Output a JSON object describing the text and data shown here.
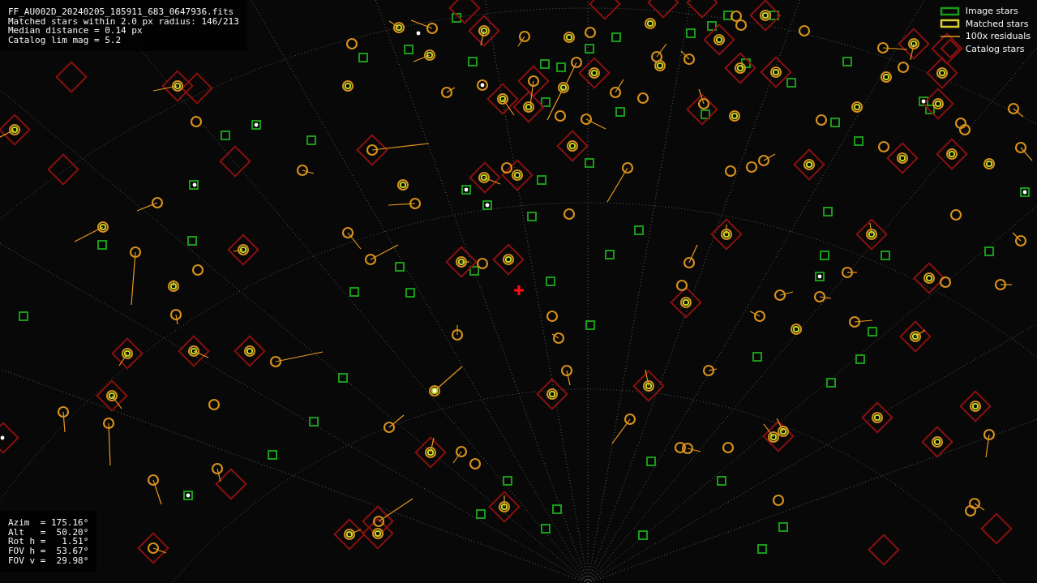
{
  "file_info": {
    "lines": [
      "FF_AU002D_20240205_185911_683_0647936.fits",
      "Matched stars within 2.0 px radius: 146/213",
      "Median distance = 0.14 px",
      "Catalog lim mag = 5.2"
    ]
  },
  "legend": [
    {
      "kind": "image",
      "label": "Image stars"
    },
    {
      "kind": "matched",
      "label": "Matched stars"
    },
    {
      "kind": "residual",
      "label": "100x residuals"
    },
    {
      "kind": "catalog",
      "label": "Catalog stars"
    }
  ],
  "pointing": {
    "lines": [
      "Azim  = 175.16°",
      "Alt   =  50.20°",
      "Rot h =   1.51°",
      "FOV h =  53.67°",
      "FOV v =  29.98°"
    ]
  }
}
